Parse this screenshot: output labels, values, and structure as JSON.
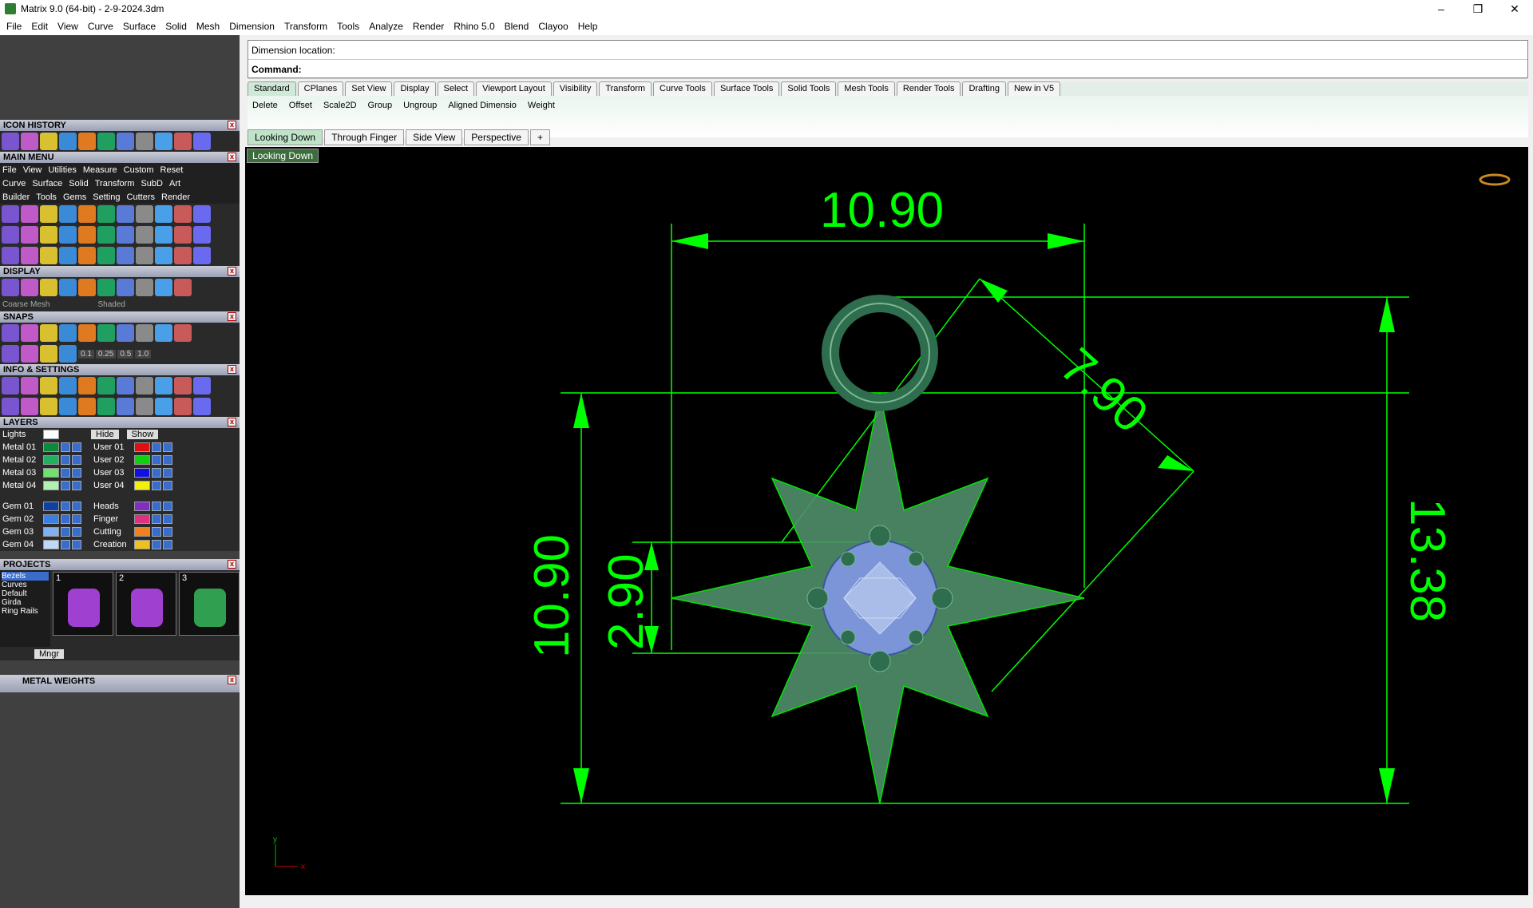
{
  "window": {
    "title": "Matrix 9.0 (64-bit) - 2-9-2024.3dm",
    "controls": [
      "–",
      "❐",
      "✕"
    ]
  },
  "menu": [
    "File",
    "Edit",
    "View",
    "Curve",
    "Surface",
    "Solid",
    "Mesh",
    "Dimension",
    "Transform",
    "Tools",
    "Analyze",
    "Render",
    "Rhino 5.0",
    "Blend",
    "Clayoo",
    "Help"
  ],
  "command": {
    "history_line": "Dimension location:",
    "prompt_label": "Command:"
  },
  "toolbar_tabs": [
    "Standard",
    "CPlanes",
    "Set View",
    "Display",
    "Select",
    "Viewport Layout",
    "Visibility",
    "Transform",
    "Curve Tools",
    "Surface Tools",
    "Solid Tools",
    "Mesh Tools",
    "Render Tools",
    "Drafting",
    "New in V5"
  ],
  "toolbar_buttons": [
    "Delete",
    "Offset",
    "Scale2D",
    "Group",
    "Ungroup",
    "Aligned Dimensio",
    "Weight"
  ],
  "viewport_tabs": [
    "Looking Down",
    "Through Finger",
    "Side View",
    "Perspective",
    "+"
  ],
  "viewport": {
    "label": "Looking Down",
    "dimensions": {
      "top_width": "10.90",
      "diagonal": "7.90",
      "left_height": "10.90",
      "stone_height": "2.90",
      "right_height": "13.38"
    },
    "axis": {
      "x": "x",
      "y": "y"
    },
    "colors": {
      "dim": "#00ff00",
      "metal": "#5fa37a",
      "gem": "#8aa7e8"
    }
  },
  "panels": {
    "icon_history": "ICON HISTORY",
    "main_menu": "MAIN MENU",
    "main_menu_items": [
      "File",
      "View",
      "Utilities",
      "Measure",
      "Custom",
      "Reset"
    ],
    "category_row1": [
      "Curve",
      "Surface",
      "Solid",
      "Transform",
      "SubD",
      "Art"
    ],
    "category_row2": [
      "Builder",
      "Tools",
      "Gems",
      "Setting",
      "Cutters",
      "Render"
    ],
    "display": "DISPLAY",
    "display_mesh": "Coarse Mesh",
    "display_mode": "Shaded",
    "snaps": "SNAPS",
    "snap_values": [
      "0.1",
      "0.25",
      "0.5",
      "1.0"
    ],
    "info": "INFO & SETTINGS",
    "layers": "LAYERS",
    "layer_lights": "Lights",
    "layer_hide": "Hide",
    "layer_show": "Show",
    "layers_left": [
      "Metal 01",
      "Metal 02",
      "Metal 03",
      "Metal 04",
      "Gem 01",
      "Gem 02",
      "Gem 03",
      "Gem 04"
    ],
    "layers_right": [
      "User 01",
      "User 02",
      "User 03",
      "User 04",
      "Heads",
      "Finger",
      "Cutting",
      "Creation"
    ],
    "projects": "PROJECTS",
    "project_list": [
      "Bezels",
      "Curves",
      "Default",
      "Girda",
      "Ring Rails"
    ],
    "project_thumbs": [
      "1",
      "2",
      "3"
    ],
    "project_btn": "Mngr",
    "metal_weights": "METAL WEIGHTS"
  }
}
